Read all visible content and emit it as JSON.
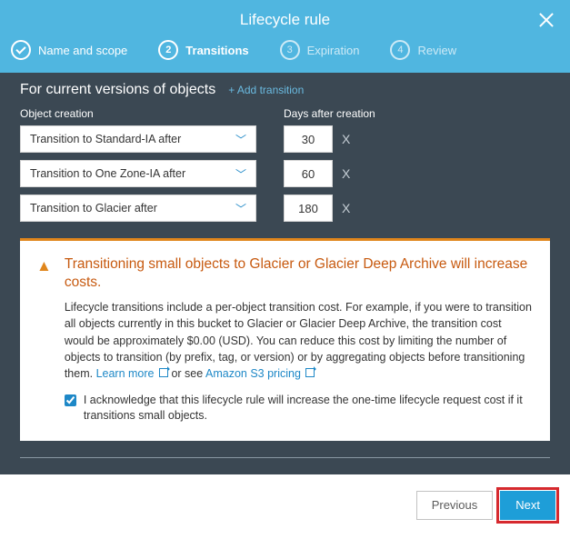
{
  "header": {
    "title": "Lifecycle rule"
  },
  "steps": [
    {
      "label": "Name and scope"
    },
    {
      "label": "Transitions"
    },
    {
      "num": "3",
      "label": "Expiration"
    },
    {
      "num": "4",
      "label": "Review"
    }
  ],
  "section": {
    "title": "For current versions of objects",
    "add_link": "+ Add transition",
    "col_object": "Object creation",
    "col_days": "Days after creation"
  },
  "rows": [
    {
      "label": "Transition to Standard-IA after",
      "days": "30"
    },
    {
      "label": "Transition to One Zone-IA after",
      "days": "60"
    },
    {
      "label": "Transition to Glacier after",
      "days": "180"
    }
  ],
  "warning": {
    "title": "Transitioning small objects to Glacier or Glacier Deep Archive will increase costs.",
    "body": "Lifecycle transitions include a per-object transition cost. For example, if you were to transition all objects currently in this bucket to Glacier or Glacier Deep Archive, the transition cost would be approximately $0.00 (USD). You can reduce this cost by limiting the number of objects to transition (by prefix, tag, or version) or by aggregating objects before transitioning them. ",
    "learn_more": "Learn more",
    "or_see": " or see ",
    "pricing": "Amazon S3 pricing",
    "ack": "I acknowledge that this lifecycle rule will increase the one-time lifecycle request cost if it transitions small objects."
  },
  "footer": {
    "previous": "Previous",
    "next": "Next"
  },
  "remove_label": "X"
}
